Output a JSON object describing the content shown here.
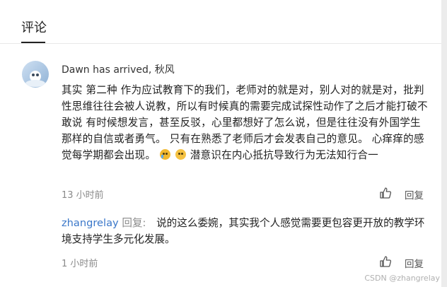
{
  "section": {
    "title": "评论"
  },
  "comment": {
    "author": "Dawn has arrived, 秋风",
    "text_before_emoji": "其实 第二种 作为应试教育下的我们，老师对的就是对，别人对的就是对，批判性思维往往会被人说教，所以有时候真的需要完成试探性动作了之后才能打破不敢说 有时候想发言，甚至反驳，心里都想好了怎么说，但是往往没有外国学生那样的自信或者勇气。  只有在熟悉了老师后才会发表自己的意见。 心痒痒的感觉每学期都会出现。",
    "text_after_emoji": "潜意识在内心抵抗导致行为无法知行合一",
    "emojis": [
      "cry-emoji",
      "sob-emoji"
    ],
    "time": "13 小时前",
    "reply_label": "回复"
  },
  "reply": {
    "user": "zhangrelay",
    "tag": "回复:",
    "text": "说的这么委婉，其实我个人感觉需要更包容更开放的教学环境支持学生多元化发展。",
    "time": "1 小时前",
    "reply_label": "回复"
  },
  "watermark": "CSDN @zhangrelay",
  "colors": {
    "background": "#ececec",
    "card": "#ffffff",
    "link": "#3a77c9",
    "muted": "#8a8a8a"
  }
}
